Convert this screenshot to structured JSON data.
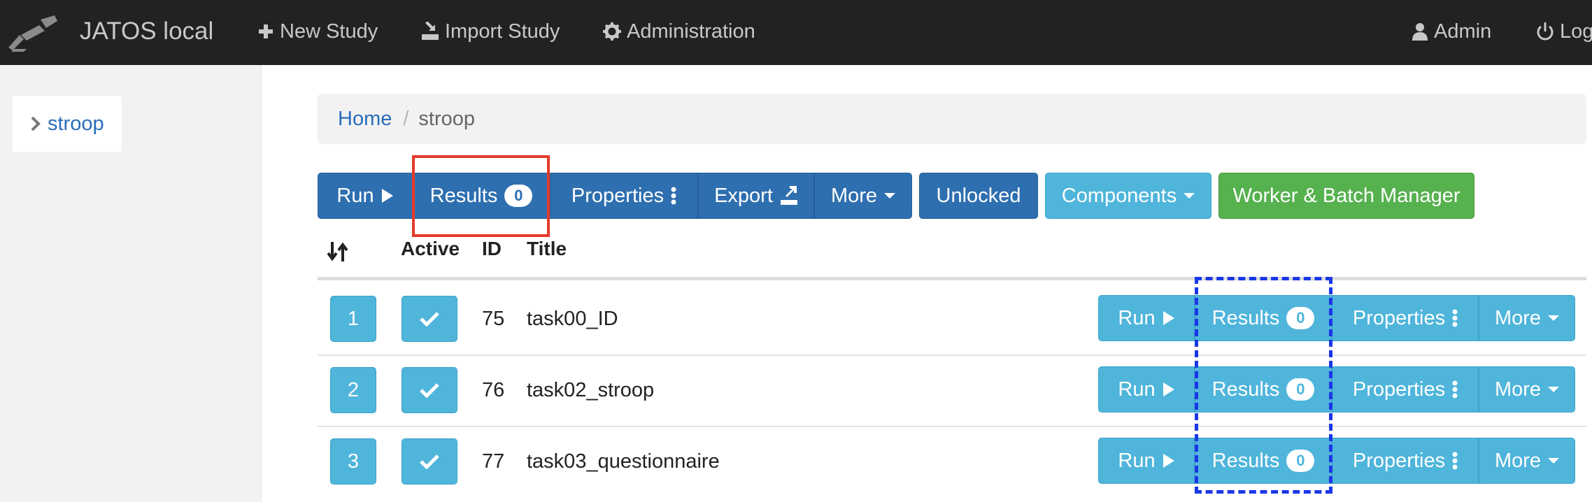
{
  "navbar": {
    "brand": "JATOS local",
    "items": [
      {
        "label": "New Study",
        "icon": "plus-icon"
      },
      {
        "label": "Import Study",
        "icon": "import-icon"
      },
      {
        "label": "Administration",
        "icon": "gear-icon"
      }
    ],
    "user": {
      "label": "Admin",
      "icon": "user-icon"
    },
    "logout": {
      "label": "Log",
      "icon": "power-icon"
    }
  },
  "sidebar": {
    "items": [
      {
        "label": "stroop",
        "icon": "chevron-right-icon"
      }
    ]
  },
  "breadcrumb": {
    "home": "Home",
    "separator": "/",
    "current": "stroop"
  },
  "toolbar": {
    "run": "Run",
    "results": "Results",
    "results_count": "0",
    "properties": "Properties",
    "export": "Export",
    "more": "More",
    "unlocked": "Unlocked",
    "components": "Components",
    "worker_batch": "Worker & Batch Manager"
  },
  "table": {
    "headers": {
      "sort_icon": "sort-icon",
      "active": "Active",
      "id": "ID",
      "title": "Title"
    },
    "rows": [
      {
        "position": "1",
        "active": true,
        "id": "75",
        "title": "task00_ID",
        "run": "Run",
        "results": "Results",
        "results_count": "0",
        "properties": "Properties",
        "more": "More"
      },
      {
        "position": "2",
        "active": true,
        "id": "76",
        "title": "task02_stroop",
        "run": "Run",
        "results": "Results",
        "results_count": "0",
        "properties": "Properties",
        "more": "More"
      },
      {
        "position": "3",
        "active": true,
        "id": "77",
        "title": "task03_questionnaire",
        "run": "Run",
        "results": "Results",
        "results_count": "0",
        "properties": "Properties",
        "more": "More"
      }
    ]
  },
  "colors": {
    "navbar_bg": "#222222",
    "primary": "#2e6fb0",
    "info": "#4fb5db",
    "success": "#56b14f",
    "annotation_red": "#e53a2c",
    "annotation_blue": "#1a37e8"
  }
}
